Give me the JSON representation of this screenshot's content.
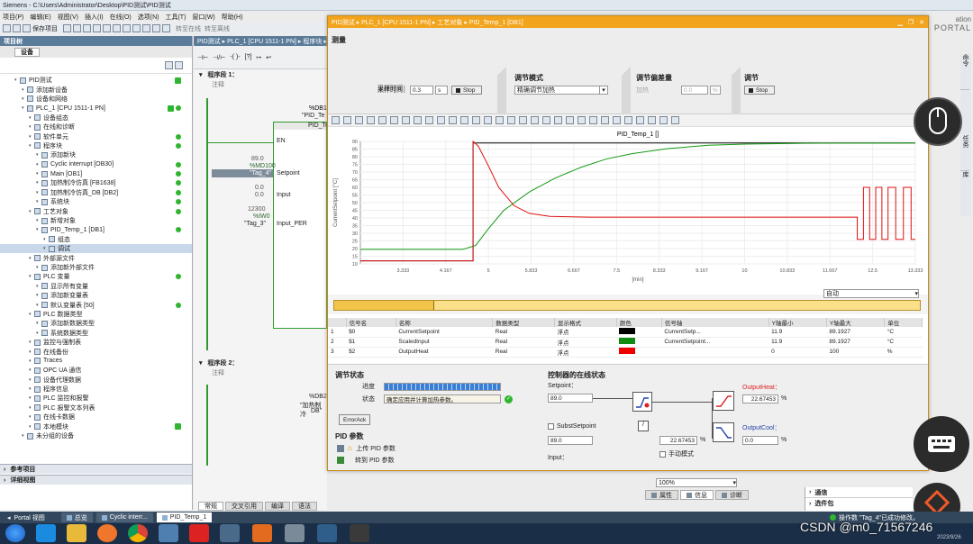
{
  "window": {
    "title": "Siemens  -  C:\\Users\\Administrator\\Desktop\\PID测试\\PID测试",
    "brand_line1": "ation",
    "brand_line2": "PORTAL"
  },
  "menu": [
    "项目(P)",
    "编辑(E)",
    "视图(V)",
    "插入(I)",
    "在线(O)",
    "选项(N)",
    "工具(T)",
    "窗口(W)",
    "帮助(H)"
  ],
  "toolbar": {
    "save_label": "保存项目",
    "go_online": "转至在线",
    "go_offline": "转至离线"
  },
  "project_tree": {
    "title": "项目树",
    "tab": "设备",
    "items": [
      {
        "label": "PID测试",
        "indent": 0,
        "check": true
      },
      {
        "label": "添加新设备",
        "indent": 1
      },
      {
        "label": "设备和网络",
        "indent": 1
      },
      {
        "label": "PLC_1 [CPU 1511-1 PN]",
        "indent": 1,
        "check": true,
        "dot": true
      },
      {
        "label": "设备组态",
        "indent": 2
      },
      {
        "label": "在线和诊断",
        "indent": 2
      },
      {
        "label": "软件单元",
        "indent": 2,
        "dot": true
      },
      {
        "label": "程序块",
        "indent": 2,
        "dot": true
      },
      {
        "label": "添加新块",
        "indent": 3
      },
      {
        "label": "Cyclic interrupt [OB30]",
        "indent": 3,
        "dot": true
      },
      {
        "label": "Main [OB1]",
        "indent": 3,
        "dot": true
      },
      {
        "label": "加热制冷仿真 [FB1638]",
        "indent": 3,
        "dot": true
      },
      {
        "label": "加热制冷仿真_DB [DB2]",
        "indent": 3,
        "dot": true
      },
      {
        "label": "系统块",
        "indent": 3,
        "dot": true
      },
      {
        "label": "工艺对象",
        "indent": 2,
        "dot": true
      },
      {
        "label": "新增对象",
        "indent": 3
      },
      {
        "label": "PID_Temp_1 [DB1]",
        "indent": 3,
        "dot": true
      },
      {
        "label": "组态",
        "indent": 4
      },
      {
        "label": "调试",
        "indent": 4,
        "selected": true
      },
      {
        "label": "外部源文件",
        "indent": 2
      },
      {
        "label": "添加新外部文件",
        "indent": 3
      },
      {
        "label": "PLC 变量",
        "indent": 2,
        "dot": true
      },
      {
        "label": "显示所有变量",
        "indent": 3
      },
      {
        "label": "添加新变量表",
        "indent": 3
      },
      {
        "label": "默认变量表 [50]",
        "indent": 3,
        "dot": true
      },
      {
        "label": "PLC 数据类型",
        "indent": 2
      },
      {
        "label": "添加新数据类型",
        "indent": 3
      },
      {
        "label": "系统数据类型",
        "indent": 3
      },
      {
        "label": "监控与强制表",
        "indent": 2
      },
      {
        "label": "在线备份",
        "indent": 2
      },
      {
        "label": "Traces",
        "indent": 2
      },
      {
        "label": "OPC UA 通信",
        "indent": 2
      },
      {
        "label": "设备代理数据",
        "indent": 2
      },
      {
        "label": "程序信息",
        "indent": 2
      },
      {
        "label": "PLC 监控和报警",
        "indent": 2
      },
      {
        "label": "PLC 报警文本列表",
        "indent": 2
      },
      {
        "label": "在线卡数据",
        "indent": 2
      },
      {
        "label": "本地模块",
        "indent": 2,
        "check": true
      },
      {
        "label": "未分组的设备",
        "indent": 1
      }
    ],
    "ref_projects": "参考项目",
    "details": "详细视图"
  },
  "editor": {
    "breadcrumb": "PID测试 ▸ PLC_1 [CPU 1511-1 PN] ▸ 程序块 ▸ M",
    "network1_title": "程序段 1：",
    "network2_title": "程序段 2：",
    "comment": "注释",
    "db_label": "%DB1",
    "db_name": "\"PID_Te",
    "block_name": "PID_Te",
    "en": "EN",
    "setpoint_val": "89.0",
    "setpoint_addr": "%MD100",
    "setpoint_tag": "\"Tag_4\"",
    "setpoint_pin": "Setpoint",
    "input_val1": "0.0",
    "input_val2": "0.0",
    "input_pin": "Input",
    "inputper_val": "12300",
    "inputper_addr": "%IW0",
    "inputper_tag": "\"Tag_3\"",
    "inputper_pin": "Input_PER",
    "db2_label": "%DB2",
    "db2_name": "\"加热制冷",
    "db2_sub": "DB\""
  },
  "bottom_tabs": [
    "常规",
    "交叉引用",
    "编译",
    "语法"
  ],
  "pid_window": {
    "breadcrumb": "PID测试 ▸ PLC_1 [CPU 1511-1 PN] ▸ 工艺对象 ▸ PID_Temp_1 [DB1]",
    "measure": {
      "title": "测量",
      "sample_label": "采样时间：",
      "sample_value": "0.3",
      "sample_unit": "s",
      "stop": "Stop"
    },
    "tuning_mode": {
      "title": "调节模式",
      "value": "精确调节加热"
    },
    "tuning_dev": {
      "title": "调节偏差量",
      "label": "加热",
      "value": "0.0",
      "unit": "%"
    },
    "tuning": {
      "title": "调节",
      "stop": "Stop"
    },
    "chart_mode": "自动",
    "table_headers": [
      "",
      "信号名",
      "名称",
      "数据类型",
      "显示格式",
      "颜色",
      "信号轴",
      "Y轴最小",
      "Y轴最大",
      "单位"
    ],
    "table_rows": [
      {
        "num": "1",
        "sig": "$0",
        "name": "CurrentSetpoint",
        "type": "Real",
        "fmt": "浮点",
        "color": "#000000",
        "axis": "CurrentSetp...",
        "ymin": "11.9",
        "ymax": "89.1927",
        "unit": "°C"
      },
      {
        "num": "2",
        "sig": "$1",
        "name": "ScaledInput",
        "type": "Real",
        "fmt": "浮点",
        "color": "#118a11",
        "axis": "CurrentSetpoint...",
        "ymin": "11.9",
        "ymax": "89.1927",
        "unit": "°C"
      },
      {
        "num": "3",
        "sig": "$2",
        "name": "OutputHeat",
        "type": "Real",
        "fmt": "浮点",
        "color": "#ee0000",
        "axis": "",
        "ymin": "0",
        "ymax": "100",
        "unit": "%"
      }
    ],
    "tuning_status": {
      "title": "调节状态",
      "progress_label": "进度",
      "progress": 1.0,
      "state_label": "状态",
      "state_value": "确定应用并计算加热参数。",
      "error_ack": "ErrorAck"
    },
    "pid_params": {
      "title": "PID 参数",
      "upload": "上传 PID 参数",
      "goto": "转到 PID 参数"
    },
    "online_status": {
      "title": "控制器的在线状态",
      "setpoint_label": "Setpoint：",
      "setpoint_value": "89.0",
      "subst_label": "SubstSetpoint",
      "subst_value": "89.0",
      "input_label": "Input：",
      "output_heat_label": "OutputHeat：",
      "output_heat_value": "22.67453",
      "output_heat_unit": "%",
      "output_cool_label": "OutputCool：",
      "output_cool_value": "0.0",
      "output_cool_unit": "%",
      "mid_value": "22.67453",
      "mid_unit": "%",
      "manual_label": "手动模式"
    }
  },
  "zoom": "100%",
  "inspector_tabs": [
    "属性",
    "信息",
    "诊断"
  ],
  "right_panel": {
    "tasks": "任务",
    "libs": "库",
    "tools": "工具",
    "cmd": "命令"
  },
  "right_bottom": {
    "comm": "通信",
    "options": "选件包"
  },
  "status_bar": {
    "portal": "Portal 视图",
    "tabs": [
      "总览",
      "Cyclic interr...",
      "PID_Temp_1"
    ],
    "message": "操作数 \"Tag_4\"已成功修改。"
  },
  "watermark": "CSDN @m0_71567246",
  "clock": "2023/9/26",
  "chart_data": {
    "type": "line",
    "title": "PID_Temp_1 []",
    "xlabel": "[min]",
    "ylabel": "CurrentSetpoint [°C]",
    "xlim": [
      2.5,
      13.333
    ],
    "ylim": [
      10,
      90
    ],
    "x_ticks": [
      "3.333",
      "4.167",
      "5",
      "5.833",
      "6.667",
      "7.5",
      "8.333",
      "9.167",
      "10",
      "10.833",
      "11.667",
      "12.5",
      "13.333"
    ],
    "y_ticks": [
      10,
      15,
      20,
      25,
      30,
      35,
      40,
      45,
      50,
      55,
      60,
      65,
      70,
      75,
      80,
      85,
      90
    ],
    "series": [
      {
        "name": "CurrentSetpoint",
        "color": "#000000",
        "x": [
          2.5,
          4.7,
          4.7,
          13.333
        ],
        "y": [
          12,
          12,
          89,
          89
        ]
      },
      {
        "name": "ScaledInput",
        "color": "#139a13",
        "x": [
          2.5,
          4.5,
          4.75,
          5.0,
          5.3,
          5.8,
          6.3,
          6.8,
          7.3,
          7.8,
          8.5,
          9.3,
          10.0,
          11.0,
          12.0,
          13.333
        ],
        "y": [
          19.5,
          19.5,
          22,
          33,
          45,
          57,
          66,
          73,
          78.5,
          82,
          85.3,
          87.5,
          88.2,
          88.7,
          88.9,
          89
        ]
      },
      {
        "name": "OutputHeat",
        "color": "#e01010",
        "x": [
          2.5,
          4.7,
          4.7,
          4.8,
          5.0,
          5.2,
          5.5,
          5.8,
          6.2,
          7.0,
          8.0,
          9.0,
          10.0,
          11.0,
          12.0,
          12.2,
          12.2,
          12.32,
          12.32,
          12.44,
          12.44,
          12.56,
          12.56,
          12.68,
          12.68,
          12.8,
          12.8,
          12.95,
          12.95,
          13.1,
          13.1,
          13.25,
          13.25,
          13.333
        ],
        "y": [
          12,
          12,
          90,
          87,
          74,
          60,
          48,
          43,
          41,
          40.5,
          40.5,
          40.5,
          40.5,
          40.5,
          40.5,
          40.5,
          26,
          26,
          60,
          60,
          26,
          26,
          60,
          60,
          26,
          26,
          60,
          60,
          26,
          26,
          60,
          60,
          26,
          26
        ]
      }
    ]
  }
}
